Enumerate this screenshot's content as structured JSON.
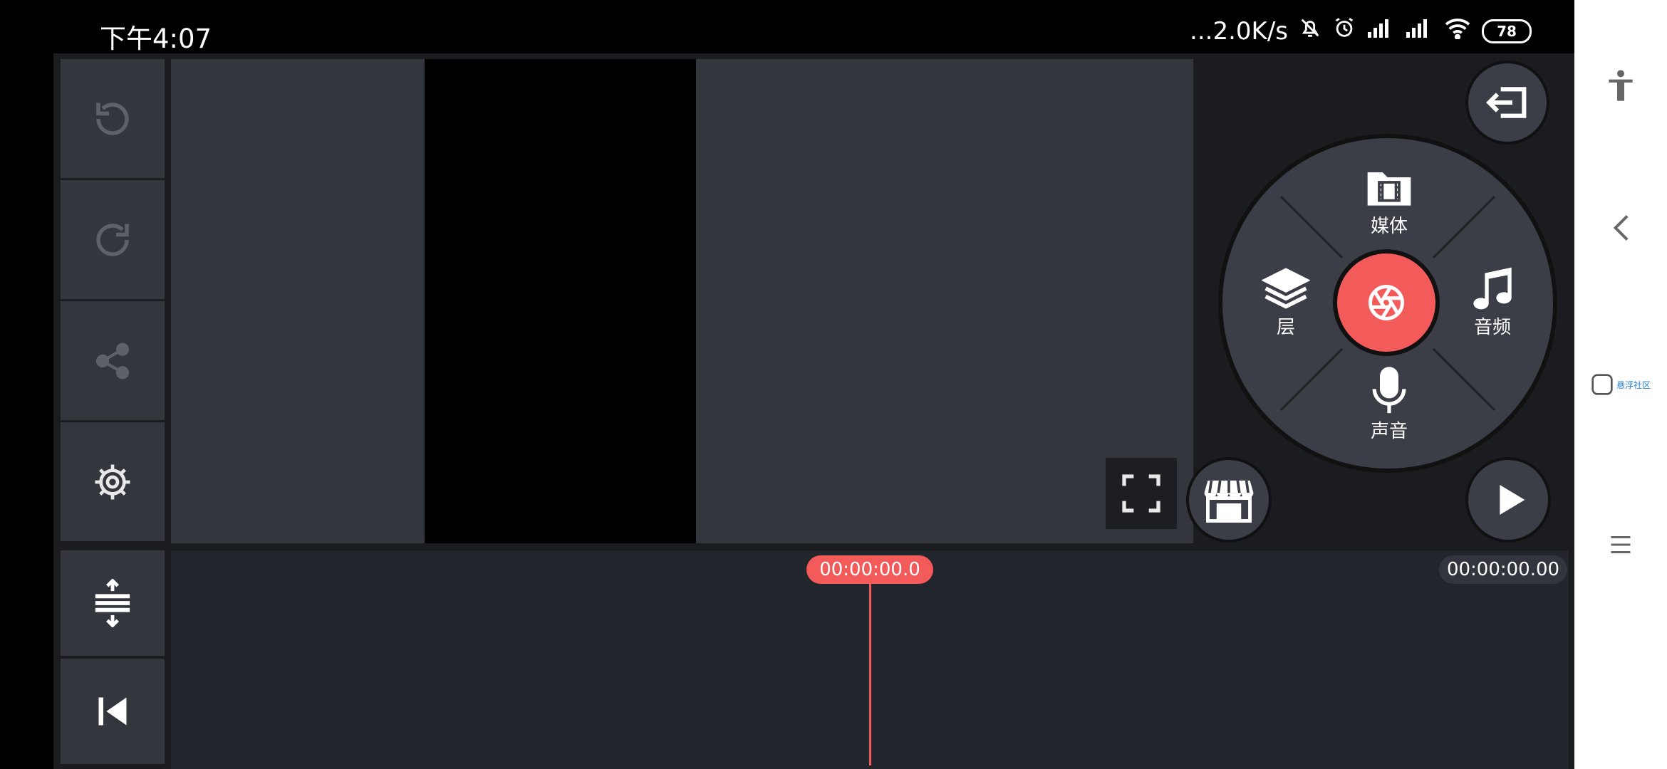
{
  "status_bar": {
    "time": "下午4:07",
    "network_speed": "...2.0K/s",
    "battery": "78"
  },
  "wheel": {
    "media_label": "媒体",
    "layer_label": "层",
    "audio_label": "音频",
    "voice_label": "声音"
  },
  "timeline": {
    "playhead_time": "00:00:00.0",
    "total_duration": "00:00:00.00"
  },
  "nav_bar": {
    "floating_label": "悬浮社区"
  },
  "colors": {
    "accent": "#f35a5a",
    "panel": "#33363d",
    "background": "#1b1c20"
  }
}
